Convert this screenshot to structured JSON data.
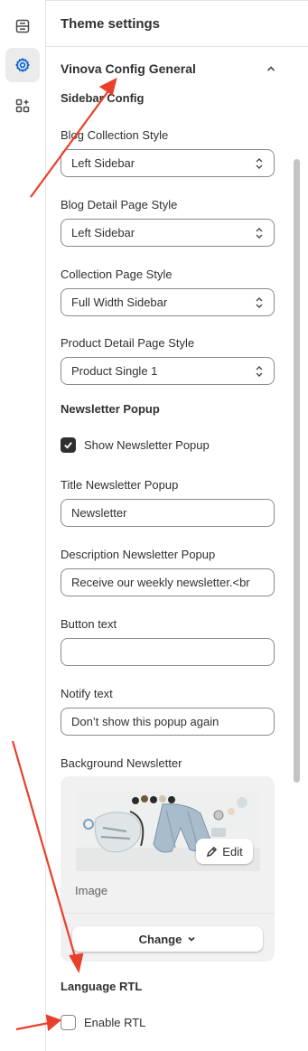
{
  "panel": {
    "title": "Theme settings"
  },
  "section": {
    "title": "Vinova Config General"
  },
  "sidebar_config": {
    "heading": "Sidebar Config",
    "blog_collection_style": {
      "label": "Blog Collection Style",
      "value": "Left Sidebar"
    },
    "blog_detail_page_style": {
      "label": "Blog Detail Page Style",
      "value": "Left Sidebar"
    },
    "collection_page_style": {
      "label": "Collection Page Style",
      "value": "Full Width Sidebar"
    },
    "product_detail_page_style": {
      "label": "Product Detail Page Style",
      "value": "Product Single 1"
    }
  },
  "newsletter": {
    "heading": "Newsletter Popup",
    "show_popup": {
      "label": "Show Newsletter Popup",
      "checked": true
    },
    "title": {
      "label": "Title Newsletter Popup",
      "value": "Newsletter"
    },
    "description": {
      "label": "Description Newsletter Popup",
      "value": "Receive our weekly newsletter.<br"
    },
    "button_text": {
      "label": "Button text",
      "value": ""
    },
    "notify_text": {
      "label": "Notify text",
      "value": "Don’t show this popup again"
    },
    "background": {
      "label": "Background Newsletter",
      "edit_label": "Edit",
      "caption": "Image",
      "change_label": "Change"
    }
  },
  "language": {
    "heading": "Language RTL",
    "enable_rtl": {
      "label": "Enable RTL",
      "checked": false
    }
  },
  "rail": {
    "items": [
      {
        "icon": "sections-icon",
        "active": false
      },
      {
        "icon": "gear-icon",
        "active": true
      },
      {
        "icon": "apps-icon",
        "active": false
      }
    ]
  },
  "colors": {
    "accent": "#303030",
    "annotation_arrow": "#e8402a",
    "active_icon": "#005bd3"
  }
}
